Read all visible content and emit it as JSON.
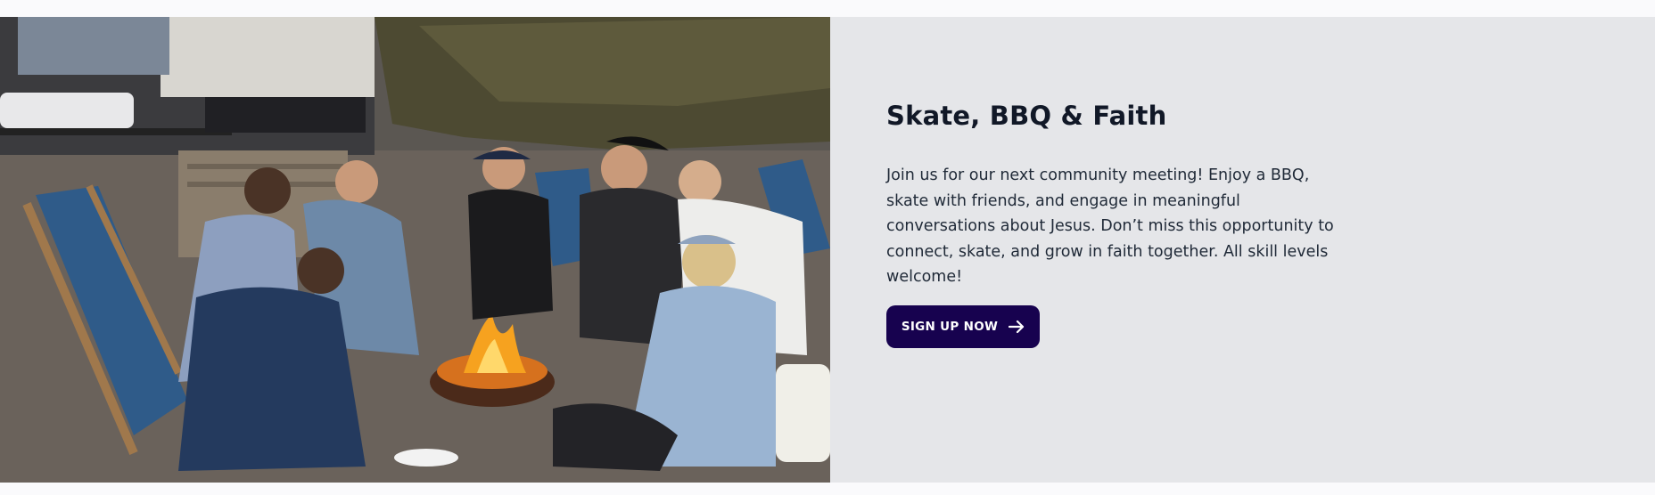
{
  "event": {
    "title": "Skate, BBQ & Faith",
    "description": "Join us for our next community meeting! Enjoy a BBQ, skate with friends, and engage in meaningful conversations about Jesus. Don’t miss this opportunity to connect, skate, and grow in faith together. All skill levels welcome!",
    "cta_label": "SIGN UP NOW",
    "cta_icon": "arrow-right-icon",
    "photo_description": "group-around-campfire-photo"
  },
  "colors": {
    "page_background": "#fafafc",
    "panel_background": "#e5e6e9",
    "title_text": "#111827",
    "body_text": "#1f2937",
    "button_background": "#17024f",
    "button_text": "#ffffff"
  }
}
